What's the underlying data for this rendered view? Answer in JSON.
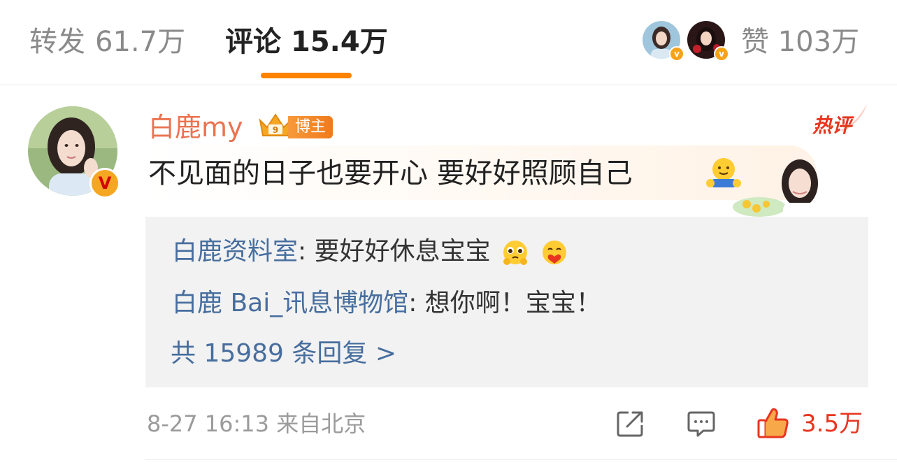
{
  "tabs": {
    "repost": {
      "label": "转发",
      "count": "61.7万"
    },
    "comment": {
      "label": "评论",
      "count": "15.4万"
    }
  },
  "likes_header": {
    "label": "赞",
    "count": "103万"
  },
  "comment": {
    "username": "白鹿my",
    "badge": "博主",
    "hot_tag": "热评",
    "text": "不见面的日子也要开心 要好好照顾自己",
    "verified_mark": "V",
    "replies": [
      {
        "author": "白鹿资料室",
        "separator": ": ",
        "text": "要好好休息宝宝"
      },
      {
        "author": "白鹿 Bai_讯息博物馆",
        "separator": ": ",
        "text": "想你啊！宝宝！"
      }
    ],
    "reply_count": "共 15989 条回复 >",
    "meta": "8-27 16:13  来自北京",
    "like_count": "3.5万"
  },
  "colors": {
    "accent_orange": "#ff8200",
    "username": "#eb7350",
    "link_blue": "#476e9e",
    "like_red": "#e8351f",
    "muted_gray": "#9b9b9b"
  },
  "icons": [
    "crown-icon",
    "hug-emoji-icon",
    "pleading-emoji-icon",
    "heart-hug-emoji-icon",
    "share-icon",
    "comment-icon",
    "thumbs-up-icon",
    "verified-icon"
  ]
}
